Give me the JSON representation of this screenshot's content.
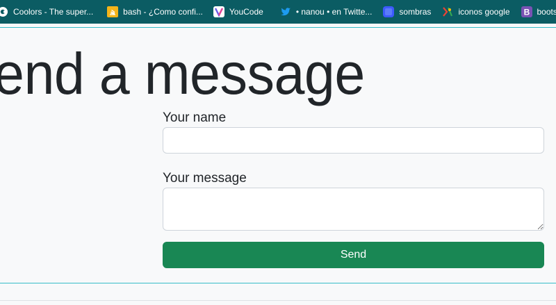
{
  "bookmarks": [
    {
      "label": "Coolors - The super...",
      "icon": "coolors-icon",
      "color": "#ffffff"
    },
    {
      "label": "bash - ¿Como confi...",
      "icon": "stackoverflow-icon",
      "color": "#f4b41a"
    },
    {
      "label": "YouCode",
      "icon": "youcode-icon",
      "color": "#6c5ce7"
    },
    {
      "label": "• nanou • en Twitte...",
      "icon": "twitter-icon",
      "color": "#1d9bf0"
    },
    {
      "label": "sombras",
      "icon": "sombras-icon",
      "color": "#3d5afe"
    },
    {
      "label": "iconos google",
      "icon": "google-fonts-icon",
      "color": "#ea4335"
    },
    {
      "label": "bootstr",
      "icon": "bootstrap-icon",
      "color": "#7952b3"
    }
  ],
  "page": {
    "heading": "end a message"
  },
  "form": {
    "name_label": "Your name",
    "name_value": "",
    "message_label": "Your message",
    "message_value": "",
    "send_label": "Send"
  },
  "colors": {
    "bookmarks_bar": "#0b5c63",
    "accent_rule": "#35bcc8",
    "send_button": "#198754",
    "page_bg": "#f8f9fa"
  }
}
